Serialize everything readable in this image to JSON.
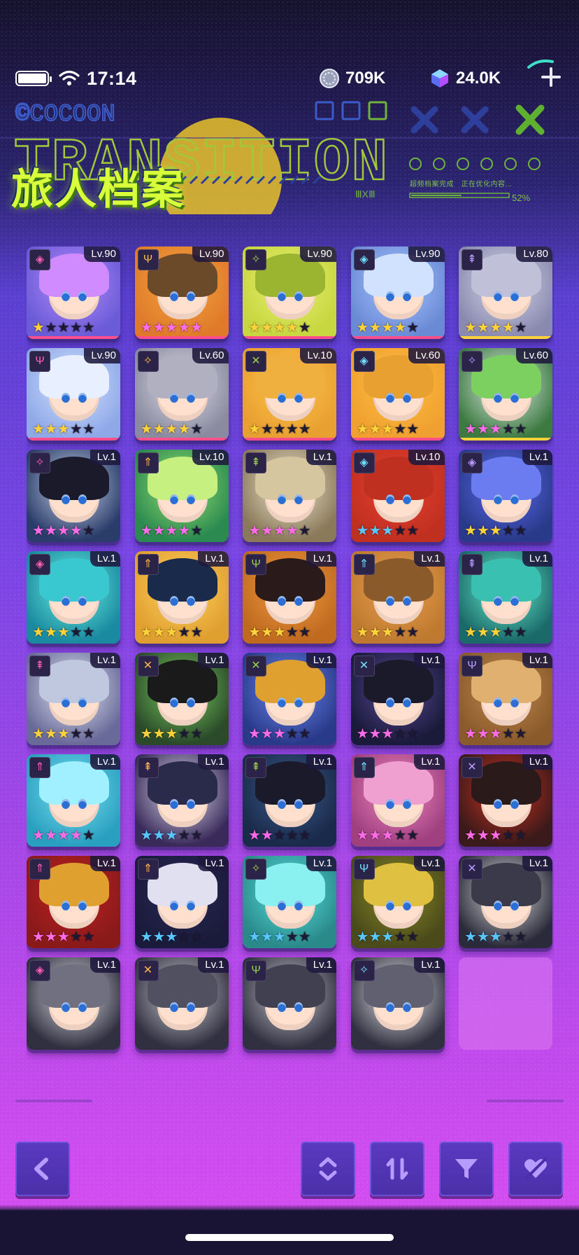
{
  "status": {
    "time": "17:14",
    "gold": "709K",
    "gems": "24.0K",
    "icons": [
      "battery-icon",
      "wifi-icon",
      "coin-icon",
      "gem-icon",
      "plus-icon"
    ]
  },
  "banner": {
    "title": "旅人档案",
    "logo_text": "©COCOON",
    "bg_word": "TRANSITION",
    "meta_text": "超频档案完成　正在优化内容...",
    "progress_text": "52%",
    "numeral": "ⅢXⅢ",
    "progress": 0.52
  },
  "colors": {
    "gold_star": "#ffd23a",
    "pink_star": "#ff6be8",
    "blue_star": "#59c7ff",
    "accent_green": "#c8ff3a",
    "button_bg": "#4f33b0"
  },
  "roster": [
    {
      "lv": "Lv.90",
      "cls": "◈",
      "stars": [
        "g",
        "g",
        "g",
        "g",
        "g"
      ],
      "on": 1
    },
    {
      "lv": "Lv.90",
      "cls": "Ψ",
      "stars": [
        "p",
        "p",
        "p",
        "p",
        "p"
      ],
      "on": 5
    },
    {
      "lv": "Lv.90",
      "cls": "✧",
      "stars": [
        "g",
        "g",
        "g",
        "g",
        "g"
      ],
      "on": 4
    },
    {
      "lv": "Lv.90",
      "cls": "◈",
      "stars": [
        "g",
        "g",
        "g",
        "g",
        "g"
      ],
      "on": 4
    },
    {
      "lv": "Lv.80",
      "cls": "⇞",
      "stars": [
        "g",
        "g",
        "g",
        "g",
        "g"
      ],
      "on": 4
    },
    {
      "lv": "Lv.90",
      "cls": "Ψ",
      "stars": [
        "g",
        "g",
        "g",
        "g",
        "g"
      ],
      "on": 3
    },
    {
      "lv": "Lv.60",
      "cls": "✧",
      "stars": [
        "g",
        "g",
        "g",
        "g",
        "g"
      ],
      "on": 4
    },
    {
      "lv": "Lv.10",
      "cls": "✕",
      "stars": [
        "g",
        "g",
        "g",
        "g",
        "g"
      ],
      "on": 1
    },
    {
      "lv": "Lv.60",
      "cls": "◈",
      "stars": [
        "g",
        "g",
        "g",
        "g",
        "g"
      ],
      "on": 3
    },
    {
      "lv": "Lv.60",
      "cls": "✧",
      "stars": [
        "p",
        "p",
        "p",
        "p",
        "p"
      ],
      "on": 3
    },
    {
      "lv": "Lv.1",
      "cls": "✧",
      "stars": [
        "p",
        "p",
        "p",
        "p",
        "p"
      ],
      "on": 4
    },
    {
      "lv": "Lv.10",
      "cls": "⇑",
      "stars": [
        "p",
        "p",
        "p",
        "p",
        "p"
      ],
      "on": 4
    },
    {
      "lv": "Lv.1",
      "cls": "⇞",
      "stars": [
        "p",
        "p",
        "p",
        "p",
        "p"
      ],
      "on": 4
    },
    {
      "lv": "Lv.10",
      "cls": "◈",
      "stars": [
        "b",
        "b",
        "b",
        "b",
        "b"
      ],
      "on": 3
    },
    {
      "lv": "Lv.1",
      "cls": "◈",
      "stars": [
        "g",
        "g",
        "g",
        "g",
        "g"
      ],
      "on": 3
    },
    {
      "lv": "Lv.1",
      "cls": "◈",
      "stars": [
        "g",
        "g",
        "g",
        "g",
        "g"
      ],
      "on": 3
    },
    {
      "lv": "Lv.1",
      "cls": "⇑",
      "stars": [
        "g",
        "g",
        "g",
        "g",
        "g"
      ],
      "on": 3
    },
    {
      "lv": "Lv.1",
      "cls": "Ψ",
      "stars": [
        "g",
        "g",
        "g",
        "g",
        "g"
      ],
      "on": 3
    },
    {
      "lv": "Lv.1",
      "cls": "⇑",
      "stars": [
        "g",
        "g",
        "g",
        "g",
        "g"
      ],
      "on": 3
    },
    {
      "lv": "Lv.1",
      "cls": "⇞",
      "stars": [
        "g",
        "g",
        "g",
        "g",
        "g"
      ],
      "on": 3
    },
    {
      "lv": "Lv.1",
      "cls": "⇞",
      "stars": [
        "g",
        "g",
        "g",
        "g",
        "g"
      ],
      "on": 3
    },
    {
      "lv": "Lv.1",
      "cls": "✕",
      "stars": [
        "g",
        "g",
        "g",
        "g",
        "g"
      ],
      "on": 3
    },
    {
      "lv": "Lv.1",
      "cls": "✕",
      "stars": [
        "p",
        "p",
        "p",
        "p",
        "p"
      ],
      "on": 3
    },
    {
      "lv": "Lv.1",
      "cls": "✕",
      "stars": [
        "p",
        "p",
        "p",
        "p",
        "p"
      ],
      "on": 3
    },
    {
      "lv": "Lv.1",
      "cls": "Ψ",
      "stars": [
        "p",
        "p",
        "p",
        "p",
        "p"
      ],
      "on": 3
    },
    {
      "lv": "Lv.1",
      "cls": "⇑",
      "stars": [
        "p",
        "p",
        "p",
        "p",
        "p"
      ],
      "on": 4
    },
    {
      "lv": "Lv.1",
      "cls": "⇞",
      "stars": [
        "b",
        "b",
        "b",
        "b",
        "b"
      ],
      "on": 3
    },
    {
      "lv": "Lv.1",
      "cls": "⇞",
      "stars": [
        "p",
        "p",
        "p",
        "p",
        "p"
      ],
      "on": 2
    },
    {
      "lv": "Lv.1",
      "cls": "⇑",
      "stars": [
        "p",
        "p",
        "p",
        "p",
        "p"
      ],
      "on": 3
    },
    {
      "lv": "Lv.1",
      "cls": "✕",
      "stars": [
        "p",
        "p",
        "p",
        "p",
        "p"
      ],
      "on": 3
    },
    {
      "lv": "Lv.1",
      "cls": "⇑",
      "stars": [
        "p",
        "p",
        "p",
        "p",
        "p"
      ],
      "on": 3
    },
    {
      "lv": "Lv.1",
      "cls": "⇑",
      "stars": [
        "b",
        "b",
        "b",
        "b",
        "b"
      ],
      "on": 3
    },
    {
      "lv": "Lv.1",
      "cls": "✧",
      "stars": [
        "b",
        "b",
        "b",
        "b",
        "b"
      ],
      "on": 3
    },
    {
      "lv": "Lv.1",
      "cls": "Ψ",
      "stars": [
        "b",
        "b",
        "b",
        "b",
        "b"
      ],
      "on": 3
    },
    {
      "lv": "Lv.1",
      "cls": "✕",
      "stars": [
        "b",
        "b",
        "b",
        "b",
        "b"
      ],
      "on": 3
    },
    {
      "lv": "Lv.1",
      "cls": "◈",
      "stars": [],
      "on": 0
    },
    {
      "lv": "Lv.1",
      "cls": "✕",
      "stars": [],
      "on": 0
    },
    {
      "lv": "Lv.1",
      "cls": "Ψ",
      "stars": [],
      "on": 0
    },
    {
      "lv": "Lv.1",
      "cls": "✧",
      "stars": [],
      "on": 0
    }
  ],
  "controls": {
    "back": "back-chevron-icon",
    "expand": "expand-collapse-icon",
    "sort": "sort-order-icon",
    "filter": "filter-funnel-icon",
    "favorite": "favorite-heart-icon"
  }
}
